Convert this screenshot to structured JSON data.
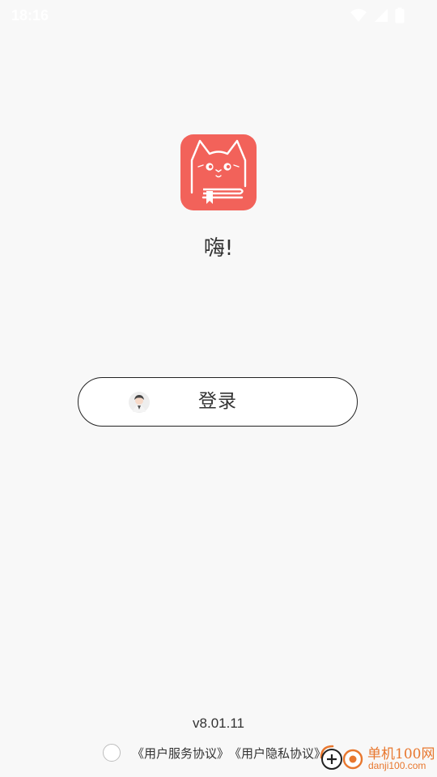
{
  "status_bar": {
    "time": "18:16",
    "icons": [
      "wifi-icon",
      "signal-icon",
      "battery-icon"
    ]
  },
  "app": {
    "logo_icon": "cat-book-logo-icon",
    "greeting": "嗨!"
  },
  "login": {
    "avatar_icon": "user-avatar-icon",
    "label": "登录"
  },
  "footer": {
    "version": "v8.01.11",
    "agreements": [
      "《用户服务协议》",
      "《用户隐私协议》"
    ]
  },
  "watermark": {
    "title": "单机100网",
    "subtitle": "danji100.com"
  },
  "colors": {
    "brand": "#f2625a",
    "background": "#f8f8f8",
    "watermark": "#e8772e"
  }
}
